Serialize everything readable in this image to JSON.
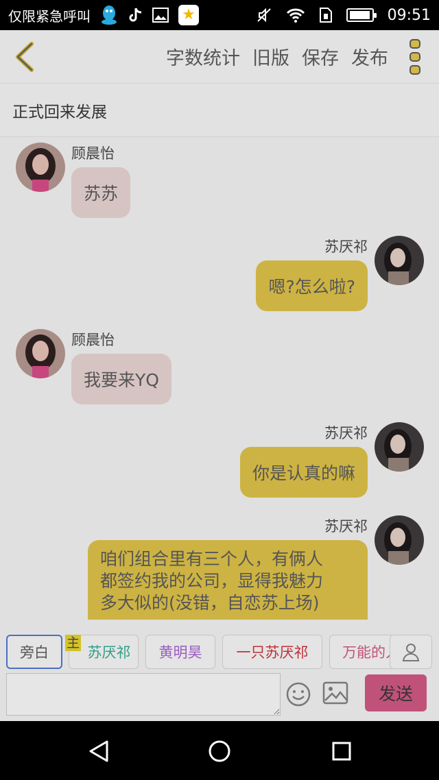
{
  "status_bar": {
    "notification_text": "仅限紧急呼叫",
    "time": "09:51",
    "icons": [
      "qq-icon",
      "tiktok-icon",
      "image-icon",
      "star-app-icon",
      "mute-icon",
      "wifi-icon",
      "sim-icon",
      "battery-icon"
    ]
  },
  "toolbar": {
    "word_count": "字数统计",
    "old_version": "旧版",
    "save": "保存",
    "publish": "发布"
  },
  "chat_title": "正式回来发展",
  "messages": [
    {
      "side": "left",
      "name": "顾晨怡",
      "text": "苏苏"
    },
    {
      "side": "right",
      "name": "苏厌祁",
      "text": "嗯?怎么啦?"
    },
    {
      "side": "left",
      "name": "顾晨怡",
      "text": "我要来YQ"
    },
    {
      "side": "right",
      "name": "苏厌祁",
      "text": "你是认真的嘛"
    },
    {
      "side": "right",
      "name": "苏厌祁",
      "lines": [
        "咱们组合里有三个人，有俩人",
        "都签约我的公司，显得我魅力",
        "多大似的(没错，自恋苏上场)"
      ]
    }
  ],
  "roles": {
    "narrator": "旁白",
    "main_tag": "主",
    "chips": [
      {
        "label": "苏厌祁",
        "color": "#2f9e8a"
      },
      {
        "label": "黄明昊",
        "color": "#9a5cc0"
      },
      {
        "label": "一只苏厌祁",
        "color": "#c0303a"
      },
      {
        "label": "万能的人",
        "color": "#c0527a"
      }
    ]
  },
  "input": {
    "value": "",
    "send": "发送"
  },
  "colors": {
    "left_bubble": "#d6c4c2",
    "right_bubble": "#cdb343",
    "send_button": "#c0527a",
    "accent": "#4b6ec0"
  }
}
